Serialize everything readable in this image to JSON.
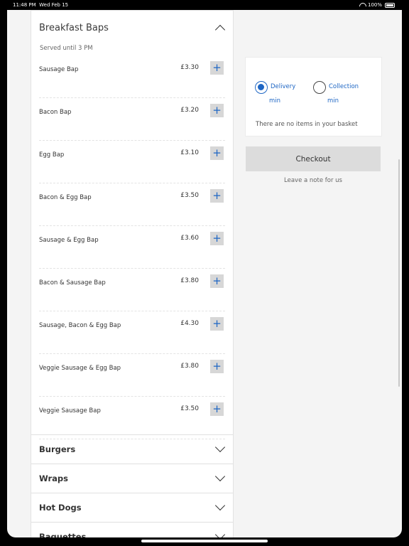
{
  "status_bar": {
    "time": "11:48 PM",
    "date": "Wed Feb 15",
    "battery": "100%"
  },
  "menu": {
    "open_section": {
      "title": "Breakfast Baps",
      "subtitle": "Served until 3 PM",
      "items": [
        {
          "name": "Sausage Bap",
          "price": "£3.30"
        },
        {
          "name": "Bacon Bap",
          "price": "£3.20"
        },
        {
          "name": "Egg Bap",
          "price": "£3.10"
        },
        {
          "name": "Bacon & Egg Bap",
          "price": "£3.50"
        },
        {
          "name": "Sausage & Egg Bap",
          "price": "£3.60"
        },
        {
          "name": "Bacon & Sausage Bap",
          "price": "£3.80"
        },
        {
          "name": "Sausage, Bacon & Egg Bap",
          "price": "£4.30"
        },
        {
          "name": "Veggie Sausage & Egg Bap",
          "price": "£3.80"
        },
        {
          "name": "Veggie Sausage Bap",
          "price": "£3.50"
        }
      ]
    },
    "collapsed_sections": [
      "Burgers",
      "Wraps",
      "Hot Dogs",
      "Baguettes"
    ]
  },
  "basket": {
    "delivery_label": "Delivery",
    "delivery_sub": "min",
    "collection_label": "Collection",
    "collection_sub": "min",
    "selected": "Delivery",
    "empty_text": "There are no items in your basket"
  },
  "checkout_label": "Checkout",
  "note_link": "Leave a note for us",
  "colors": {
    "accent": "#1e66c4",
    "button_bg": "#dcdcdc",
    "page_bg": "#f4f4f4"
  },
  "icons": {
    "add": "plus-icon",
    "expand": "chevron-down-icon",
    "collapse": "chevron-up-icon"
  }
}
